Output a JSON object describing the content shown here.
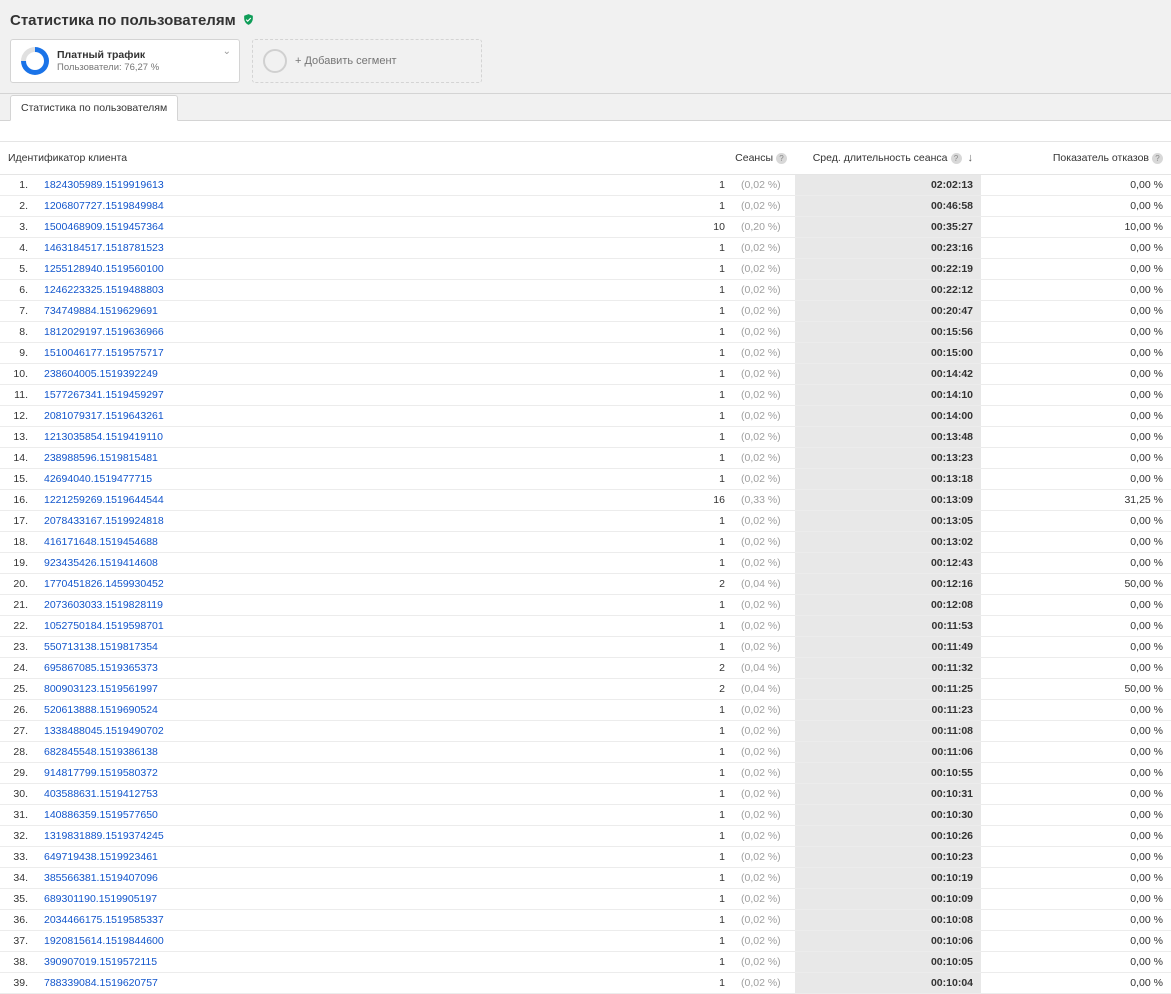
{
  "header": {
    "title": "Статистика по пользователям"
  },
  "segments": {
    "active": {
      "label": "Платный трафик",
      "sub": "Пользователи: 76,27 %"
    },
    "add_label": "+ Добавить сегмент"
  },
  "tabs": {
    "active": "Статистика по пользователям"
  },
  "columns": {
    "client": "Идентификатор клиента",
    "sessions": "Сеансы",
    "duration": "Сред. длительность сеанса",
    "bounce": "Показатель отказов"
  },
  "rows": [
    {
      "n": 1,
      "id": "1824305989.1519919613",
      "sess": "1",
      "pct": "(0,02 %)",
      "dur": "02:02:13",
      "bounce": "0,00 %"
    },
    {
      "n": 2,
      "id": "1206807727.1519849984",
      "sess": "1",
      "pct": "(0,02 %)",
      "dur": "00:46:58",
      "bounce": "0,00 %"
    },
    {
      "n": 3,
      "id": "1500468909.1519457364",
      "sess": "10",
      "pct": "(0,20 %)",
      "dur": "00:35:27",
      "bounce": "10,00 %"
    },
    {
      "n": 4,
      "id": "1463184517.1518781523",
      "sess": "1",
      "pct": "(0,02 %)",
      "dur": "00:23:16",
      "bounce": "0,00 %"
    },
    {
      "n": 5,
      "id": "1255128940.1519560100",
      "sess": "1",
      "pct": "(0,02 %)",
      "dur": "00:22:19",
      "bounce": "0,00 %"
    },
    {
      "n": 6,
      "id": "1246223325.1519488803",
      "sess": "1",
      "pct": "(0,02 %)",
      "dur": "00:22:12",
      "bounce": "0,00 %"
    },
    {
      "n": 7,
      "id": "734749884.1519629691",
      "sess": "1",
      "pct": "(0,02 %)",
      "dur": "00:20:47",
      "bounce": "0,00 %"
    },
    {
      "n": 8,
      "id": "1812029197.1519636966",
      "sess": "1",
      "pct": "(0,02 %)",
      "dur": "00:15:56",
      "bounce": "0,00 %"
    },
    {
      "n": 9,
      "id": "1510046177.1519575717",
      "sess": "1",
      "pct": "(0,02 %)",
      "dur": "00:15:00",
      "bounce": "0,00 %"
    },
    {
      "n": 10,
      "id": "238604005.1519392249",
      "sess": "1",
      "pct": "(0,02 %)",
      "dur": "00:14:42",
      "bounce": "0,00 %"
    },
    {
      "n": 11,
      "id": "1577267341.1519459297",
      "sess": "1",
      "pct": "(0,02 %)",
      "dur": "00:14:10",
      "bounce": "0,00 %"
    },
    {
      "n": 12,
      "id": "2081079317.1519643261",
      "sess": "1",
      "pct": "(0,02 %)",
      "dur": "00:14:00",
      "bounce": "0,00 %"
    },
    {
      "n": 13,
      "id": "1213035854.1519419110",
      "sess": "1",
      "pct": "(0,02 %)",
      "dur": "00:13:48",
      "bounce": "0,00 %"
    },
    {
      "n": 14,
      "id": "238988596.1519815481",
      "sess": "1",
      "pct": "(0,02 %)",
      "dur": "00:13:23",
      "bounce": "0,00 %"
    },
    {
      "n": 15,
      "id": "42694040.1519477715",
      "sess": "1",
      "pct": "(0,02 %)",
      "dur": "00:13:18",
      "bounce": "0,00 %"
    },
    {
      "n": 16,
      "id": "1221259269.1519644544",
      "sess": "16",
      "pct": "(0,33 %)",
      "dur": "00:13:09",
      "bounce": "31,25 %"
    },
    {
      "n": 17,
      "id": "2078433167.1519924818",
      "sess": "1",
      "pct": "(0,02 %)",
      "dur": "00:13:05",
      "bounce": "0,00 %"
    },
    {
      "n": 18,
      "id": "416171648.1519454688",
      "sess": "1",
      "pct": "(0,02 %)",
      "dur": "00:13:02",
      "bounce": "0,00 %"
    },
    {
      "n": 19,
      "id": "923435426.1519414608",
      "sess": "1",
      "pct": "(0,02 %)",
      "dur": "00:12:43",
      "bounce": "0,00 %"
    },
    {
      "n": 20,
      "id": "1770451826.1459930452",
      "sess": "2",
      "pct": "(0,04 %)",
      "dur": "00:12:16",
      "bounce": "50,00 %"
    },
    {
      "n": 21,
      "id": "2073603033.1519828119",
      "sess": "1",
      "pct": "(0,02 %)",
      "dur": "00:12:08",
      "bounce": "0,00 %"
    },
    {
      "n": 22,
      "id": "1052750184.1519598701",
      "sess": "1",
      "pct": "(0,02 %)",
      "dur": "00:11:53",
      "bounce": "0,00 %"
    },
    {
      "n": 23,
      "id": "550713138.1519817354",
      "sess": "1",
      "pct": "(0,02 %)",
      "dur": "00:11:49",
      "bounce": "0,00 %"
    },
    {
      "n": 24,
      "id": "695867085.1519365373",
      "sess": "2",
      "pct": "(0,04 %)",
      "dur": "00:11:32",
      "bounce": "0,00 %"
    },
    {
      "n": 25,
      "id": "800903123.1519561997",
      "sess": "2",
      "pct": "(0,04 %)",
      "dur": "00:11:25",
      "bounce": "50,00 %"
    },
    {
      "n": 26,
      "id": "520613888.1519690524",
      "sess": "1",
      "pct": "(0,02 %)",
      "dur": "00:11:23",
      "bounce": "0,00 %"
    },
    {
      "n": 27,
      "id": "1338488045.1519490702",
      "sess": "1",
      "pct": "(0,02 %)",
      "dur": "00:11:08",
      "bounce": "0,00 %"
    },
    {
      "n": 28,
      "id": "682845548.1519386138",
      "sess": "1",
      "pct": "(0,02 %)",
      "dur": "00:11:06",
      "bounce": "0,00 %"
    },
    {
      "n": 29,
      "id": "914817799.1519580372",
      "sess": "1",
      "pct": "(0,02 %)",
      "dur": "00:10:55",
      "bounce": "0,00 %"
    },
    {
      "n": 30,
      "id": "403588631.1519412753",
      "sess": "1",
      "pct": "(0,02 %)",
      "dur": "00:10:31",
      "bounce": "0,00 %"
    },
    {
      "n": 31,
      "id": "140886359.1519577650",
      "sess": "1",
      "pct": "(0,02 %)",
      "dur": "00:10:30",
      "bounce": "0,00 %"
    },
    {
      "n": 32,
      "id": "1319831889.1519374245",
      "sess": "1",
      "pct": "(0,02 %)",
      "dur": "00:10:26",
      "bounce": "0,00 %"
    },
    {
      "n": 33,
      "id": "649719438.1519923461",
      "sess": "1",
      "pct": "(0,02 %)",
      "dur": "00:10:23",
      "bounce": "0,00 %"
    },
    {
      "n": 34,
      "id": "385566381.1519407096",
      "sess": "1",
      "pct": "(0,02 %)",
      "dur": "00:10:19",
      "bounce": "0,00 %"
    },
    {
      "n": 35,
      "id": "689301190.1519905197",
      "sess": "1",
      "pct": "(0,02 %)",
      "dur": "00:10:09",
      "bounce": "0,00 %"
    },
    {
      "n": 36,
      "id": "2034466175.1519585337",
      "sess": "1",
      "pct": "(0,02 %)",
      "dur": "00:10:08",
      "bounce": "0,00 %"
    },
    {
      "n": 37,
      "id": "1920815614.1519844600",
      "sess": "1",
      "pct": "(0,02 %)",
      "dur": "00:10:06",
      "bounce": "0,00 %"
    },
    {
      "n": 38,
      "id": "390907019.1519572115",
      "sess": "1",
      "pct": "(0,02 %)",
      "dur": "00:10:05",
      "bounce": "0,00 %"
    },
    {
      "n": 39,
      "id": "788339084.1519620757",
      "sess": "1",
      "pct": "(0,02 %)",
      "dur": "00:10:04",
      "bounce": "0,00 %"
    }
  ]
}
